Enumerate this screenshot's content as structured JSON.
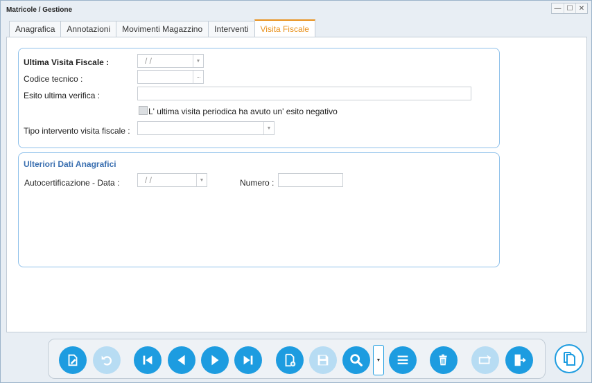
{
  "window": {
    "title": "Matricole / Gestione",
    "controls": {
      "minimize": "—",
      "maximize": "☐",
      "close": "✕"
    }
  },
  "tabs": [
    {
      "label": "Anagrafica",
      "active": false
    },
    {
      "label": "Annotazioni",
      "active": false
    },
    {
      "label": "Movimenti Magazzino",
      "active": false
    },
    {
      "label": "Interventi",
      "active": false
    },
    {
      "label": "Visita Fiscale",
      "active": true
    }
  ],
  "visita": {
    "ultima_label": "Ultima Visita Fiscale :",
    "ultima_value": "/ /",
    "codice_label": "Codice tecnico :",
    "codice_value": "",
    "esito_label": "Esito ultima verifica :",
    "esito_value": "",
    "negativo_label": "L' ultima visita periodica ha avuto un' esito negativo",
    "negativo_checked": false,
    "tipo_label": "Tipo intervento visita fiscale :",
    "tipo_value": ""
  },
  "ulteriori": {
    "title": "Ulteriori Dati Anagrafici",
    "autocert_label": "Autocertificazione - Data :",
    "autocert_value": "/ /",
    "numero_label": "Numero :",
    "numero_value": ""
  },
  "toolbar": {
    "buttons": [
      {
        "name": "edit-button",
        "icon": "edit-document-icon",
        "enabled": true
      },
      {
        "name": "undo-button",
        "icon": "undo-icon",
        "enabled": false
      },
      {
        "name": "first-record-button",
        "icon": "skip-first-icon",
        "enabled": true
      },
      {
        "name": "previous-record-button",
        "icon": "previous-icon",
        "enabled": true
      },
      {
        "name": "next-record-button",
        "icon": "next-icon",
        "enabled": true
      },
      {
        "name": "last-record-button",
        "icon": "skip-last-icon",
        "enabled": true
      },
      {
        "name": "new-record-button",
        "icon": "new-document-icon",
        "enabled": true
      },
      {
        "name": "save-button",
        "icon": "save-icon",
        "enabled": false
      },
      {
        "name": "search-button",
        "icon": "search-icon",
        "enabled": true
      },
      {
        "name": "list-button",
        "icon": "list-icon",
        "enabled": true
      },
      {
        "name": "delete-button",
        "icon": "trash-icon",
        "enabled": true
      },
      {
        "name": "print-button",
        "icon": "print-icon",
        "enabled": false
      },
      {
        "name": "exit-button",
        "icon": "exit-door-icon",
        "enabled": true
      }
    ],
    "side_button": "copy-documents-icon"
  },
  "colors": {
    "accent": "#1d9ce0",
    "accent_disabled": "#b7dcf3",
    "active_tab": "#e8901a",
    "group_border": "#8ec0ea",
    "group_title": "#3a6fb0"
  }
}
